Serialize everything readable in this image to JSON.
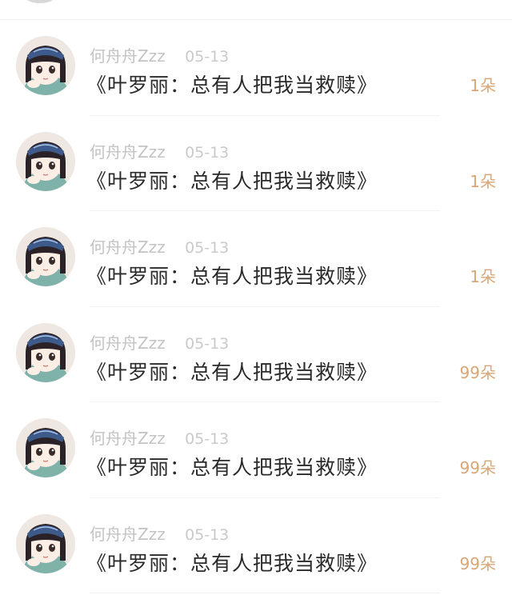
{
  "comments": [
    {
      "username": "何舟舟Zzz",
      "date": "05-13",
      "content": "《叶罗丽：总有人把我当救赎》",
      "flower_count": "1朵"
    },
    {
      "username": "何舟舟Zzz",
      "date": "05-13",
      "content": "《叶罗丽：总有人把我当救赎》",
      "flower_count": "1朵"
    },
    {
      "username": "何舟舟Zzz",
      "date": "05-13",
      "content": "《叶罗丽：总有人把我当救赎》",
      "flower_count": "1朵"
    },
    {
      "username": "何舟舟Zzz",
      "date": "05-13",
      "content": "《叶罗丽：总有人把我当救赎》",
      "flower_count": "99朵"
    },
    {
      "username": "何舟舟Zzz",
      "date": "05-13",
      "content": "《叶罗丽：总有人把我当救赎》",
      "flower_count": "99朵"
    },
    {
      "username": "何舟舟Zzz",
      "date": "05-13",
      "content": "《叶罗丽：总有人把我当救赎》",
      "flower_count": "99朵"
    }
  ],
  "colors": {
    "username": "#c3c3c3",
    "content": "#2a2a2a",
    "flower_count": "#d9a676"
  }
}
